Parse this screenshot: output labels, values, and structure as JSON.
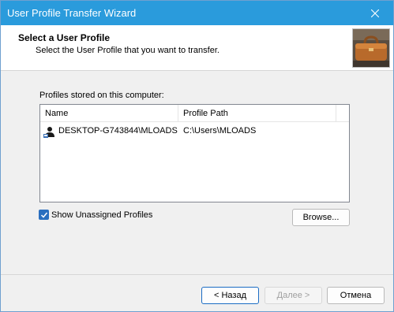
{
  "window": {
    "title": "User Profile Transfer Wizard"
  },
  "header": {
    "title": "Select a User Profile",
    "subtitle": "Select the User Profile that you want to transfer."
  },
  "profiles": {
    "label": "Profiles stored on this computer:",
    "columns": {
      "name": "Name",
      "path": "Profile Path"
    },
    "rows": [
      {
        "name": "DESKTOP-G743844\\MLOADS",
        "path": "C:\\Users\\MLOADS"
      }
    ]
  },
  "options": {
    "show_unassigned_label": "Show Unassigned Profiles",
    "show_unassigned_checked": true
  },
  "buttons": {
    "browse": "Browse...",
    "back": "< Назад",
    "next": "Далее >",
    "cancel": "Отмена"
  },
  "colors": {
    "titlebar": "#2a9bdc",
    "checkbox": "#2a6fbf"
  }
}
